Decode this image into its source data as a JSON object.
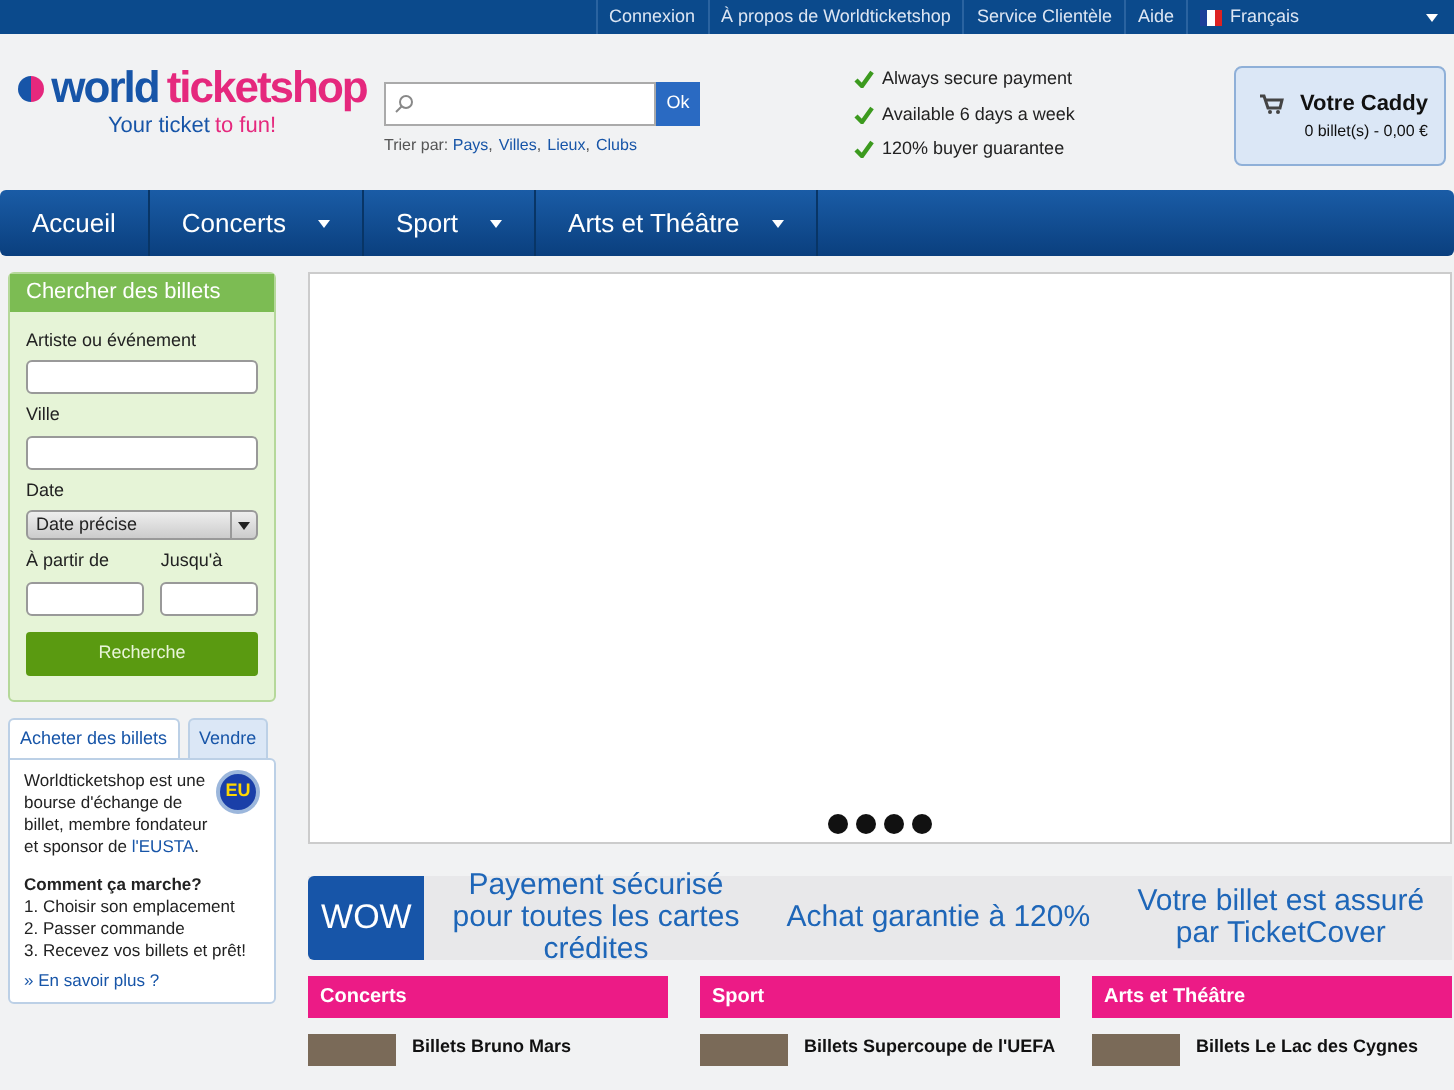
{
  "top_links": [
    "Connexion",
    "À propos de Worldticketshop",
    "Service Clientèle",
    "Aide"
  ],
  "language": "Français",
  "logo": {
    "name_part1": "world",
    "name_part2": "ticketshop",
    "tagline_part1": "Your ticket",
    "tagline_part2": "to fun!"
  },
  "search": {
    "button": "Ok",
    "sort_label": "Trier par:",
    "sort_separator": ",",
    "sort_links": [
      "Pays",
      "Villes",
      "Lieux",
      "Clubs"
    ]
  },
  "guarantees": [
    "Always secure payment",
    "Available 6 days a week",
    "120% buyer guarantee"
  ],
  "cart": {
    "title": "Votre Caddy",
    "summary": "0 billet(s) - 0,00 €"
  },
  "nav": [
    {
      "label": "Accueil",
      "dropdown": false
    },
    {
      "label": "Concerts",
      "dropdown": true
    },
    {
      "label": "Sport",
      "dropdown": true
    },
    {
      "label": "Arts et Théâtre",
      "dropdown": true
    }
  ],
  "search_panel": {
    "title": "Chercher des billets",
    "artist_label": "Artiste ou événement",
    "city_label": "Ville",
    "date_label": "Date",
    "date_option": "Date précise",
    "from_label": "À partir de",
    "to_label": "Jusqu'à",
    "button": "Recherche"
  },
  "info_tabs": [
    {
      "label": "Acheter des billets",
      "selected": true
    },
    {
      "label": "Vendre",
      "selected": false
    }
  ],
  "info": {
    "badge": "EU",
    "text": "Worldticketshop est une bourse d'échange de billet, membre fondateur et sponsor de",
    "link": "l'EUSTA",
    "after_link": ".",
    "how_title": "Comment ça marche?",
    "steps": [
      "1. Choisir son emplacement",
      "2. Passer commande",
      "3. Recevez vos billets et prêt!"
    ],
    "more": "» En savoir plus ?"
  },
  "banner": {
    "tag": "WOW",
    "items": [
      "Payement sécurisé pour toutes les cartes crédites",
      "Achat garantie à 120%",
      "Votre billet est assuré par TicketCover"
    ]
  },
  "categories": [
    {
      "title": "Concerts",
      "event": "Billets Bruno Mars"
    },
    {
      "title": "Sport",
      "event": "Billets Supercoupe de l'UEFA"
    },
    {
      "title": "Arts et Théâtre",
      "event": "Billets Le Lac des Cygnes"
    }
  ]
}
